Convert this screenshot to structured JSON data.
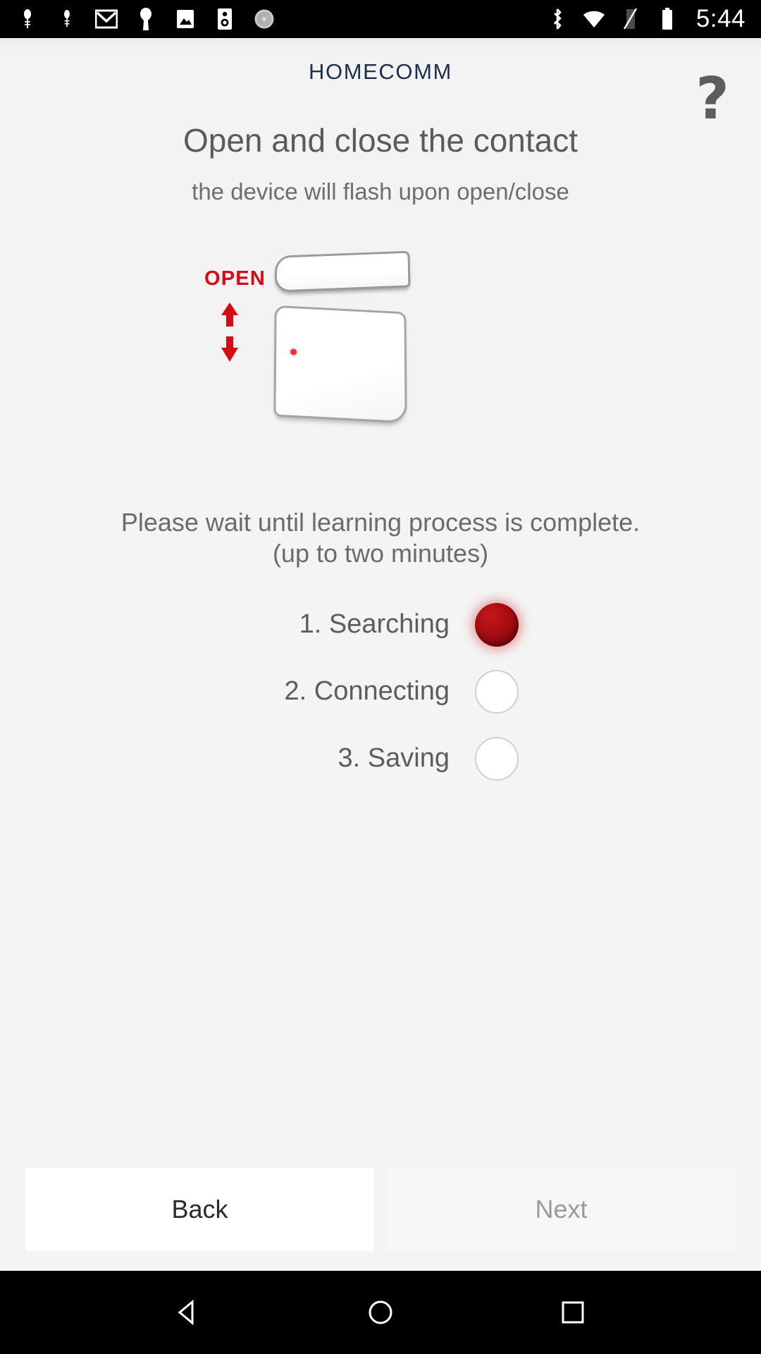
{
  "statusbar": {
    "time": "5:44",
    "left_icons": [
      "location-pin-icon",
      "location-pin-icon",
      "gmail-icon",
      "key-icon",
      "photos-icon",
      "speaker-icon",
      "disc-icon"
    ],
    "right_icons": [
      "bluetooth-icon",
      "wifi-icon",
      "no-sim-icon",
      "battery-icon"
    ]
  },
  "header": {
    "brand": "HOMECOMM",
    "help_glyph": "?"
  },
  "main": {
    "title": "Open and close the contact",
    "subtitle": "the device will flash upon open/close",
    "illustration": {
      "open_label": "OPEN",
      "arrow_color": "#d60a14",
      "led_color": "#e4323c"
    },
    "wait_line1": "Please wait until learning process is complete.",
    "wait_line2": "(up to two minutes)",
    "steps": [
      {
        "label": "1. Searching",
        "state": "on"
      },
      {
        "label": "2. Connecting",
        "state": "off"
      },
      {
        "label": "3. Saving",
        "state": "off"
      }
    ]
  },
  "footer": {
    "back_label": "Back",
    "next_label": "Next"
  },
  "colors": {
    "brand": "#1c3049",
    "accent_red": "#d60a14",
    "led_on": "#a50d12",
    "background": "#f2f2f2"
  },
  "navbar": {
    "back": "nav-back-icon",
    "home": "nav-home-icon",
    "recents": "nav-recents-icon"
  }
}
